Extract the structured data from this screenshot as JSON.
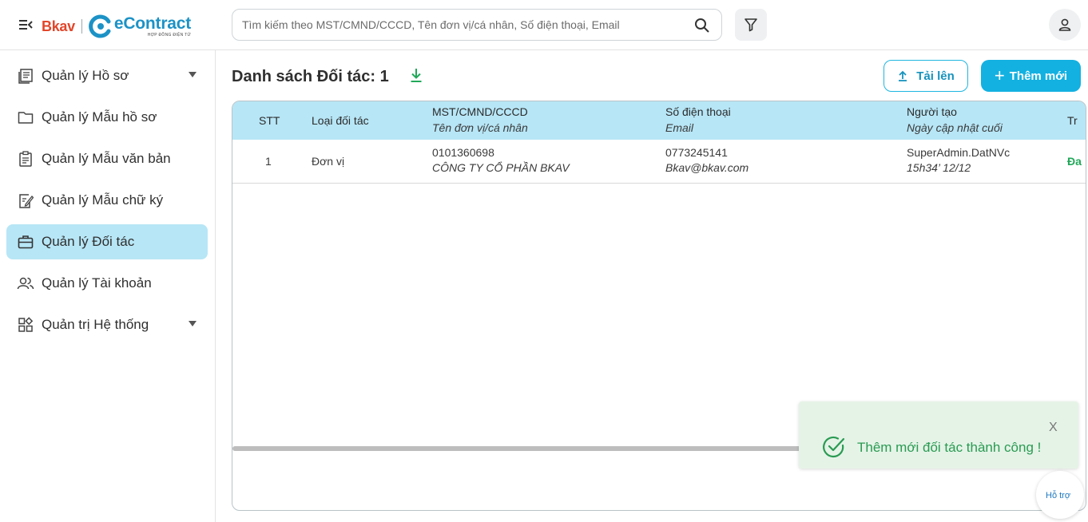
{
  "header": {
    "logo_bkav": "Bkav",
    "logo_econtract": "eContract",
    "logo_sub": "HỢP ĐỒNG ĐIỆN TỬ",
    "search_placeholder": "Tìm kiếm theo MST/CMND/CCCD, Tên đơn vị/cá nhân, Số điện thoại, Email"
  },
  "sidebar": {
    "items": [
      {
        "label": "Quản lý Hồ sơ",
        "icon": "file-stack-icon",
        "caret": true,
        "active": false
      },
      {
        "label": "Quản lý Mẫu hồ sơ",
        "icon": "folder-icon",
        "caret": false,
        "active": false
      },
      {
        "label": "Quản lý Mẫu văn bản",
        "icon": "clipboard-icon",
        "caret": false,
        "active": false
      },
      {
        "label": "Quản lý Mẫu chữ ký",
        "icon": "signature-icon",
        "caret": false,
        "active": false
      },
      {
        "label": "Quản lý Đối tác",
        "icon": "briefcase-icon",
        "caret": false,
        "active": true
      },
      {
        "label": "Quản lý Tài khoản",
        "icon": "users-icon",
        "caret": false,
        "active": false
      },
      {
        "label": "Quản trị Hệ thống",
        "icon": "grid-icon",
        "caret": true,
        "active": false
      }
    ]
  },
  "main": {
    "title": "Danh sách Đối tác: 1",
    "upload_label": "Tải lên",
    "add_label": "Thêm mới"
  },
  "table": {
    "headers": {
      "stt": "STT",
      "type": "Loại đối tác",
      "tax": "MST/CMND/CCCD",
      "tax_sub": "Tên đơn vị/cá nhân",
      "phone": "Số điện thoại",
      "phone_sub": "Email",
      "creator": "Người tạo",
      "creator_sub": "Ngày cập nhật cuối",
      "status": "Tr"
    },
    "rows": [
      {
        "stt": "1",
        "type": "Đơn vị",
        "tax": "0101360698",
        "name": "CÔNG TY CỔ PHẦN BKAV",
        "phone": "0773245141",
        "email": "Bkav@bkav.com",
        "creator": "SuperAdmin.DatNVc",
        "updated": "15h34’ 12/12",
        "status": "Đa"
      }
    ]
  },
  "toast": {
    "message": "Thêm mới đối tác thành công !",
    "close": "X"
  },
  "support": {
    "label": "Hỗ trợ"
  },
  "colors": {
    "accent": "#13b1e1",
    "active_bg": "#b7e6f6",
    "success": "#2a9b52"
  }
}
